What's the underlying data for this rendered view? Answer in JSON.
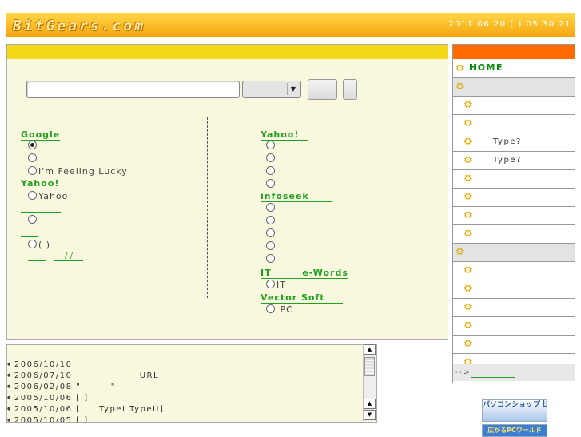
{
  "header": {
    "logo": "BitGears.com",
    "datetime": "2011 06 20 ( ) 05 30 21"
  },
  "search": {
    "input_value": "",
    "input_placeholder": "",
    "select_value": "",
    "go_label": "",
    "sub_label": ""
  },
  "engines_left": {
    "google": {
      "title": "Google",
      "options": [
        "",
        "",
        "I'm Feeling Lucky"
      ],
      "selected_index": 0
    },
    "yahoo": {
      "title": "Yahoo!",
      "options": [
        "Yahoo!"
      ]
    },
    "blank_group_1": {
      "title": "",
      "options": [
        ""
      ]
    },
    "blank_group_2": {
      "title": "",
      "options": [
        "(     )"
      ],
      "links": [
        "",
        "/ /"
      ]
    }
  },
  "engines_right": {
    "yahoo": {
      "title": "Yahoo!",
      "options": [
        "",
        "",
        "",
        ""
      ]
    },
    "infoseek": {
      "title": "infoseek",
      "options": [
        "",
        "",
        "",
        "",
        ""
      ]
    },
    "ewords": {
      "title": "IT        e-Words",
      "options": [
        "IT"
      ]
    },
    "vector": {
      "title": "Vector Soft",
      "options": [
        "PC"
      ]
    }
  },
  "news": [
    "2006/10/10",
    "2006/07/10                  URL",
    "2006/02/08 \"        \"",
    "2005/10/06 [  ]",
    "2005/10/06 [     TypeI TypeII]",
    "2005/10/05 [  ]"
  ],
  "sidebar": {
    "home_label": "HOME",
    "items": [
      {
        "kind": "head",
        "label": ""
      },
      {
        "kind": "sub",
        "label": ""
      },
      {
        "kind": "sub",
        "label": ""
      },
      {
        "kind": "sub",
        "label": "Type?"
      },
      {
        "kind": "sub",
        "label": "Type?"
      },
      {
        "kind": "sub",
        "label": ""
      },
      {
        "kind": "sub",
        "label": ""
      },
      {
        "kind": "sub",
        "label": ""
      },
      {
        "kind": "sub",
        "label": ""
      },
      {
        "kind": "head",
        "label": ""
      },
      {
        "kind": "sub",
        "label": ""
      },
      {
        "kind": "sub",
        "label": ""
      },
      {
        "kind": "sub",
        "label": ""
      },
      {
        "kind": "sub",
        "label": ""
      },
      {
        "kind": "sub",
        "label": ""
      },
      {
        "kind": "sub",
        "label": ""
      }
    ],
    "footer_label": "-->"
  },
  "banners": {
    "pc_shop": "パソコンショップ 比較",
    "pc_world": "広がるPCワールド"
  },
  "colors": {
    "header": "#f5a40c",
    "main_bar": "#f5d816",
    "sidebar_bar": "#ff6a00",
    "link": "#20a020",
    "panel_bg": "#f9f8df"
  },
  "icons": {
    "sidebar_head": "sun-gear-icon",
    "sidebar_sub": "gears-icon"
  }
}
